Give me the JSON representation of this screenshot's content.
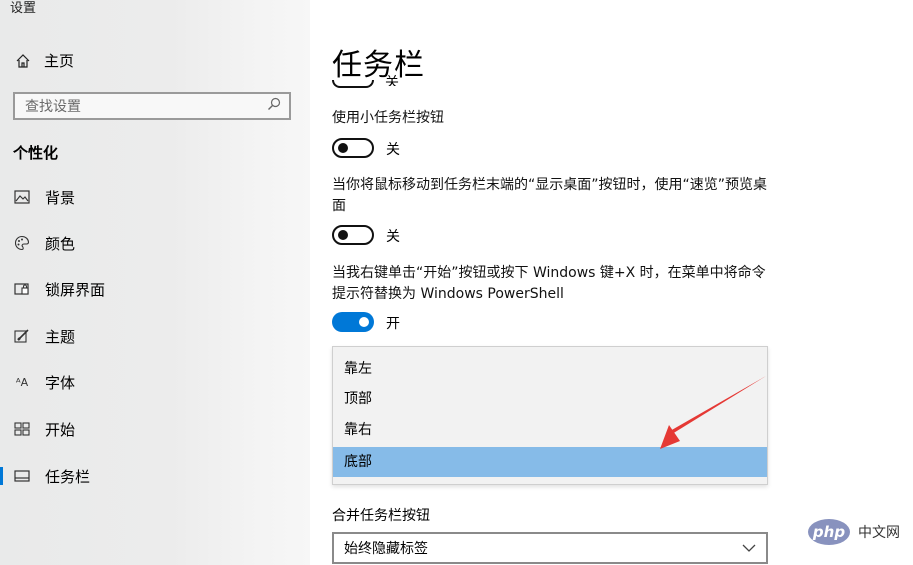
{
  "app": {
    "title": "设置"
  },
  "sidebar": {
    "home_label": "主页",
    "search_placeholder": "查找设置",
    "section_title": "个性化",
    "items": [
      {
        "label": "背景",
        "icon": "image-icon"
      },
      {
        "label": "颜色",
        "icon": "palette-icon"
      },
      {
        "label": "锁屏界面",
        "icon": "lock-screen-icon"
      },
      {
        "label": "主题",
        "icon": "theme-brush-icon"
      },
      {
        "label": "字体",
        "icon": "font-icon",
        "icon_glyph": "ᴬA"
      },
      {
        "label": "开始",
        "icon": "start-grid-icon"
      },
      {
        "label": "任务栏",
        "icon": "taskbar-icon",
        "active": true
      }
    ]
  },
  "main": {
    "title": "任务栏",
    "partial_toggle_state": "关",
    "settings": [
      {
        "label": "使用小任务栏按钮",
        "state": "关",
        "on": false
      },
      {
        "label": "当你将鼠标移动到任务栏末端的“显示桌面”按钮时，使用“速览”预览桌面",
        "state": "关",
        "on": false
      },
      {
        "label": "当我右键单击“开始”按钮或按下 Windows 键+X 时，在菜单中将命令提示符替换为 Windows PowerShell",
        "state": "开",
        "on": true
      }
    ],
    "position_options": [
      "靠左",
      "顶部",
      "靠右",
      "底部"
    ],
    "position_selected": "底部",
    "combine_label": "合并任务栏按钮",
    "combine_value": "始终隐藏标签"
  },
  "watermark": {
    "logo": "php",
    "text": "中文网"
  },
  "colors": {
    "accent": "#0078d7",
    "selected_option": "#86bbe8",
    "arrow": "#e53935"
  }
}
